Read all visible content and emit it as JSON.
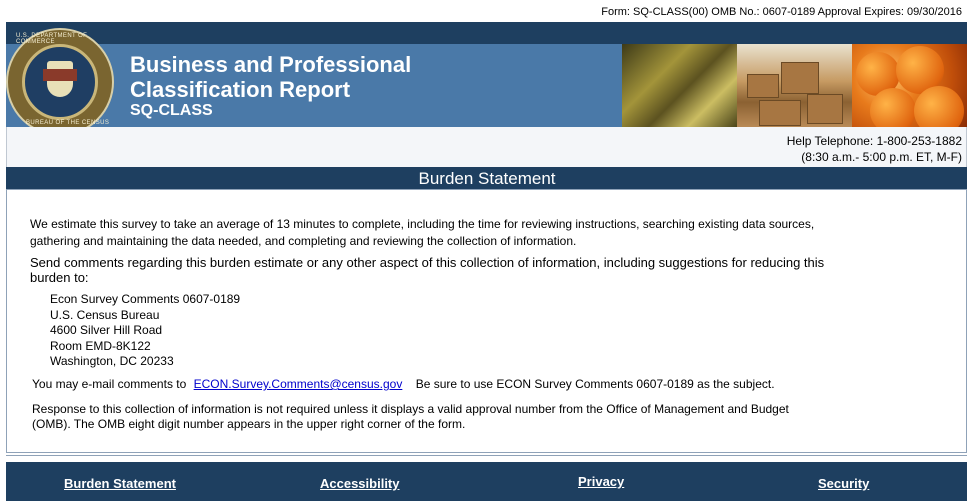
{
  "header": {
    "form_info": "Form: SQ-CLASS(00)   OMB No.: 0607-0189   Approval Expires:  09/30/2016",
    "seal_text_top": "U.S. DEPARTMENT OF COMMERCE",
    "seal_text_bottom": "BUREAU OF THE CENSUS",
    "title_line1": "Business and Professional",
    "title_line2": "Classification Report",
    "subtitle": "SQ-CLASS",
    "help_phone": "Help Telephone:  1-800-253-1882",
    "help_hours": "(8:30 a.m.- 5:00 p.m. ET, M-F)"
  },
  "section": {
    "title": "Burden Statement"
  },
  "body": {
    "estimate": "We estimate this survey to take an average of 13 minutes to complete,  including the time for reviewing instructions, searching existing data sources, gathering and maintaining the data needed, and completing and reviewing the collection of information.",
    "send_comments": "Send comments regarding this burden estimate or any other aspect of this collection of information, including suggestions for reducing this burden to:",
    "address": {
      "line1": "Econ Survey Comments 0607-0189",
      "line2": "U.S. Census Bureau",
      "line3": "4600 Silver Hill Road",
      "line4": "Room EMD-8K122",
      "line5": "Washington, DC 20233"
    },
    "email_prefix": "You may e-mail comments to",
    "email_link": "ECON.Survey.Comments@census.gov",
    "email_suffix": "Be sure to use ECON Survey Comments 0607-0189 as the subject.",
    "response": "Response to this collection of information is not required unless it displays a valid approval number from the Office of Management and Budget (OMB).   The OMB eight digit number appears in the upper right corner of the form."
  },
  "footer": {
    "links": [
      "Burden Statement",
      "Accessibility",
      "Privacy",
      "Security"
    ]
  },
  "colors": {
    "banner": "#4a79a8",
    "navy": "#1e3f60",
    "link": "#0000cc"
  }
}
